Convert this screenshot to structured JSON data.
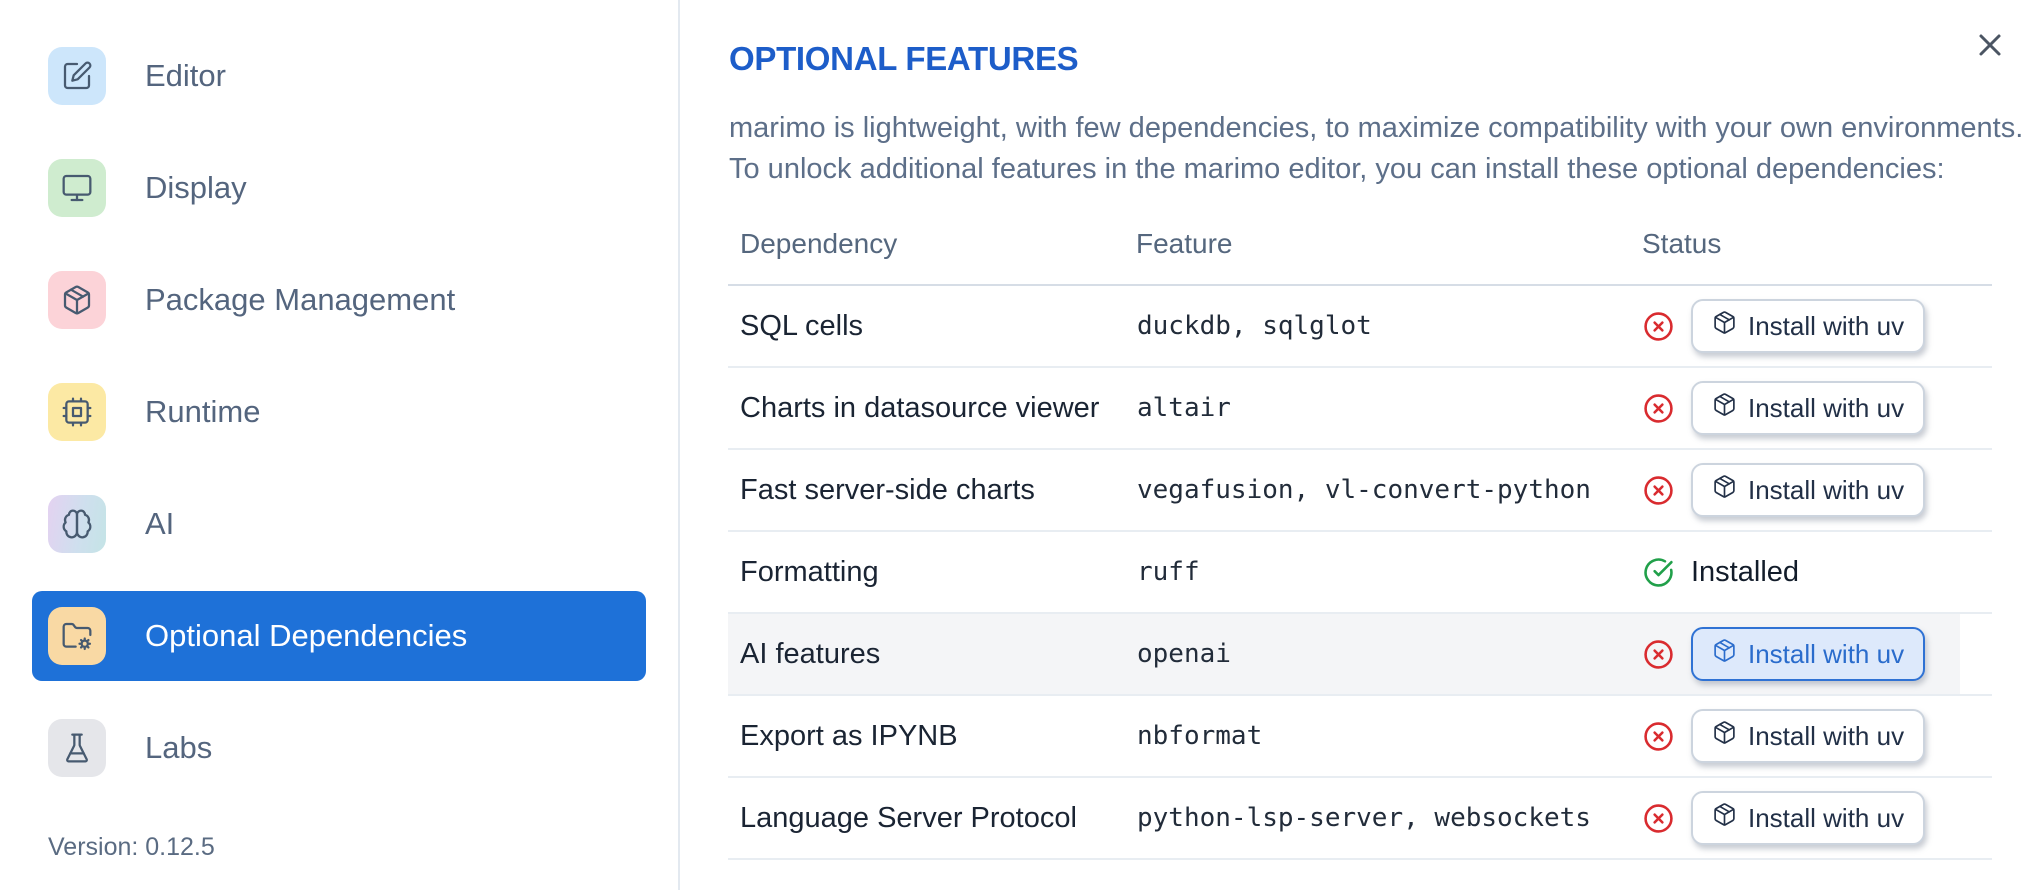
{
  "sidebar": {
    "items": [
      {
        "label": "Editor",
        "icon": "square-pen-icon",
        "icon_bg": "#cde6fb"
      },
      {
        "label": "Display",
        "icon": "monitor-icon",
        "icon_bg": "#cfeccf"
      },
      {
        "label": "Package Management",
        "icon": "package-icon",
        "icon_bg": "#fcd3d8"
      },
      {
        "label": "Runtime",
        "icon": "cpu-icon",
        "icon_bg": "#fce9a4"
      },
      {
        "label": "AI",
        "icon": "brain-icon",
        "icon_bg": "linear-gradient(100deg,#e4d2f1,#cfdfee 55%,#c4e4e6)"
      },
      {
        "label": "Optional Dependencies",
        "icon": "folder-cog-icon",
        "icon_bg": "#f9d9a4",
        "selected": true
      },
      {
        "label": "Labs",
        "icon": "flask-icon",
        "icon_bg": "#e5e6ea"
      }
    ],
    "version_label": "Version: 0.12.5"
  },
  "panel": {
    "title": "OPTIONAL FEATURES",
    "description_lines": [
      "marimo is lightweight, with few dependencies, to maximize compatibility with your own environments.",
      "To unlock additional features in the marimo editor, you can install these optional dependencies:"
    ]
  },
  "table": {
    "headers": [
      "Dependency",
      "Feature",
      "Status"
    ],
    "rows": [
      {
        "dependency": "SQL cells",
        "feature": "duckdb, sqlglot",
        "status": "not_installed",
        "action": "Install with uv"
      },
      {
        "dependency": "Charts in datasource viewer",
        "feature": "altair",
        "status": "not_installed",
        "action": "Install with uv"
      },
      {
        "dependency": "Fast server-side charts",
        "feature": "vegafusion, vl-convert-python",
        "status": "not_installed",
        "action": "Install with uv"
      },
      {
        "dependency": "Formatting",
        "feature": "ruff",
        "status": "installed",
        "status_label": "Installed"
      },
      {
        "dependency": "AI features",
        "feature": "openai",
        "status": "not_installed",
        "action": "Install with uv",
        "highlighted": true,
        "focused": true
      },
      {
        "dependency": "Export as IPYNB",
        "feature": "nbformat",
        "status": "not_installed",
        "action": "Install with uv"
      },
      {
        "dependency": "Language Server Protocol",
        "feature": "python-lsp-server, websockets",
        "status": "not_installed",
        "action": "Install with uv"
      }
    ]
  },
  "colors": {
    "accent_blue": "#1e71d8",
    "title_blue": "#1d5dc9",
    "focus_blue": "#2f72d4",
    "error_red": "#d92b2f",
    "success_green": "#21a04a",
    "row_highlight": "#f4f5f7"
  }
}
